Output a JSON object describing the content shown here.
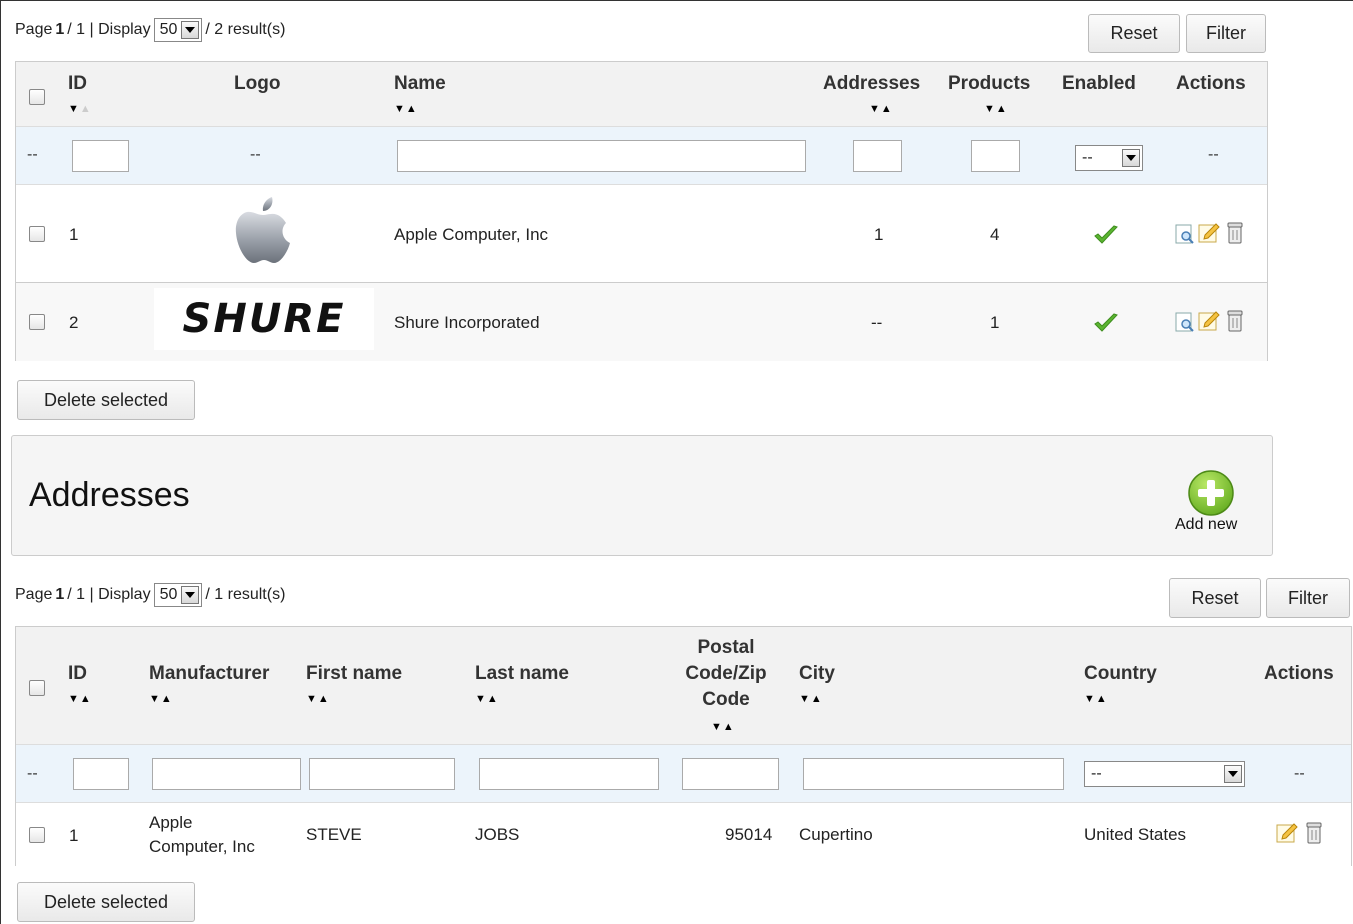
{
  "manufacturers": {
    "pager": {
      "page_prefix": "Page",
      "page_current": "1",
      "page_total": " / 1 | Display",
      "per_page": "50",
      "results": "/ 2 result(s)"
    },
    "reset_label": "Reset",
    "filter_label": "Filter",
    "columns": {
      "id": "ID",
      "logo": "Logo",
      "name": "Name",
      "addresses": "Addresses",
      "products": "Products",
      "enabled": "Enabled",
      "actions": "Actions"
    },
    "filter_row": {
      "checkbox_dash": "--",
      "logo_dash": "--",
      "enabled_value": "--",
      "actions_dash": "--"
    },
    "rows": [
      {
        "id": "1",
        "logo": "apple-logo",
        "name": "Apple Computer, Inc",
        "addresses": "1",
        "products": "4",
        "enabled": true
      },
      {
        "id": "2",
        "logo": "shure-logo",
        "logo_text": "SHURE",
        "name": "Shure Incorporated",
        "addresses": "--",
        "products": "1",
        "enabled": true
      }
    ],
    "delete_label": "Delete selected"
  },
  "addresses_panel": {
    "title": "Addresses",
    "add_new_label": "Add new",
    "add_icon": "plus-circle-icon"
  },
  "addresses": {
    "pager": {
      "page_prefix": "Page",
      "page_current": "1",
      "page_total": " / 1 | Display",
      "per_page": "50",
      "results": "/ 1 result(s)"
    },
    "reset_label": "Reset",
    "filter_label": "Filter",
    "columns": {
      "id": "ID",
      "manufacturer": "Manufacturer",
      "first_name": "First name",
      "last_name": "Last name",
      "postal_1": "Postal",
      "postal_2": "Code/Zip",
      "postal_3": "Code",
      "city": "City",
      "country": "Country",
      "actions": "Actions"
    },
    "filter_row": {
      "checkbox_dash": "--",
      "country_value": "--",
      "actions_dash": "--"
    },
    "rows": [
      {
        "id": "1",
        "manufacturer_1": "Apple",
        "manufacturer_2": "Computer, Inc",
        "first_name": "STEVE",
        "last_name": "JOBS",
        "postal": "95014",
        "city": "Cupertino",
        "country": "United States"
      }
    ],
    "delete_label": "Delete selected"
  },
  "colors": {
    "enabled_check": "#5cb531",
    "add_new_green": "#7cc32a",
    "filter_row_bg": "#ecf4fb"
  }
}
